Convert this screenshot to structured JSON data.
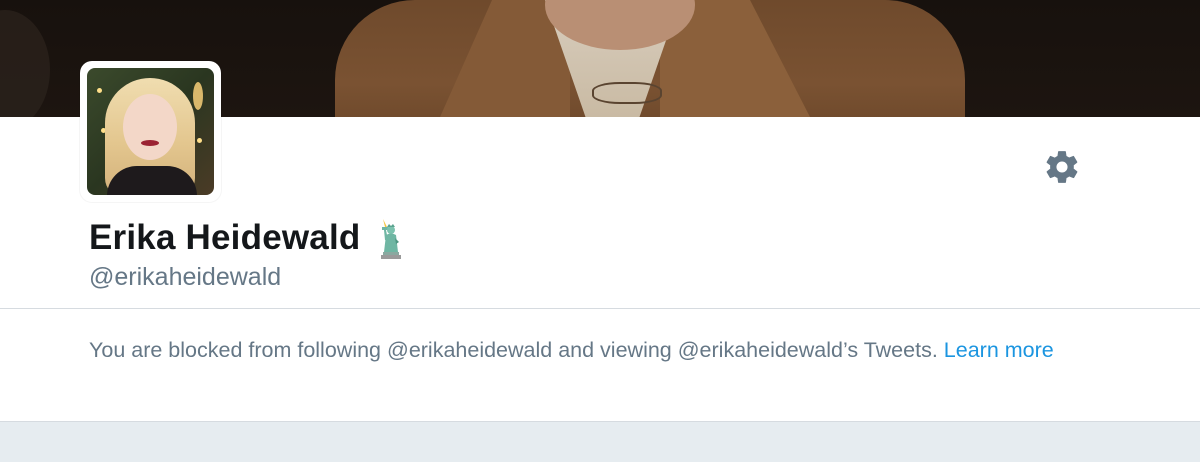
{
  "profile": {
    "display_name": "Erika Heidewald",
    "username": "@erikaheidewald",
    "name_emoji_icon": "statue-of-liberty-icon"
  },
  "notice": {
    "text": "You are blocked from following @erikaheidewald and viewing @erikaheidewald’s Tweets.",
    "link_label": "Learn more"
  },
  "settings": {
    "icon": "gear-icon"
  },
  "colors": {
    "name": "#14171a",
    "secondary_text": "#657786",
    "link": "#1b95e0",
    "divider": "#d6dbe0",
    "bottom_panel": "#e6ecf0"
  }
}
